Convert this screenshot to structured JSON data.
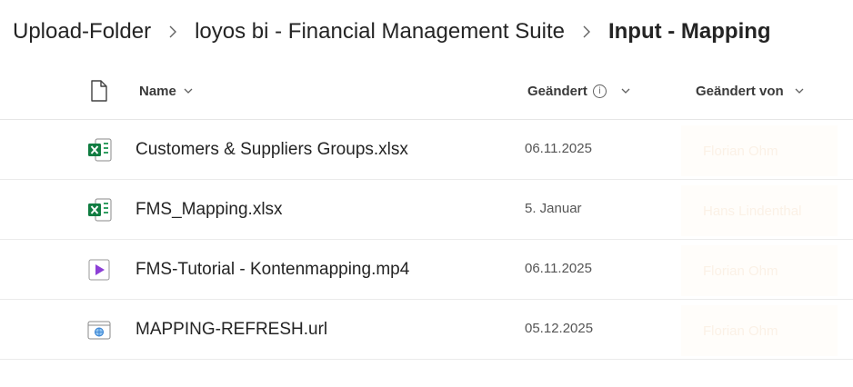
{
  "breadcrumb": {
    "items": [
      {
        "label": "Upload-Folder"
      },
      {
        "label": "loyos bi - Financial Management Suite"
      },
      {
        "label": "Input - Mapping"
      }
    ]
  },
  "columns": {
    "name": "Name",
    "modified": "Geändert",
    "modified_by": "Geändert von"
  },
  "files": [
    {
      "name": "Customers & Suppliers Groups.xlsx",
      "modified": "06.11.2025",
      "modified_by": "Florian Ohm",
      "icon": "excel-icon"
    },
    {
      "name": "FMS_Mapping.xlsx",
      "modified": "5. Januar",
      "modified_by": "Hans Lindenthal",
      "icon": "excel-icon"
    },
    {
      "name": "FMS-Tutorial - Kontenmapping.mp4",
      "modified": "06.11.2025",
      "modified_by": "Florian Ohm",
      "icon": "video-icon"
    },
    {
      "name": "MAPPING-REFRESH.url",
      "modified": "05.12.2025",
      "modified_by": "Florian Ohm",
      "icon": "link-file-icon"
    }
  ],
  "colors": {
    "excel_green": "#107c41",
    "video_purple": "#8c3fd6",
    "link_blue": "#2c7bd0"
  }
}
